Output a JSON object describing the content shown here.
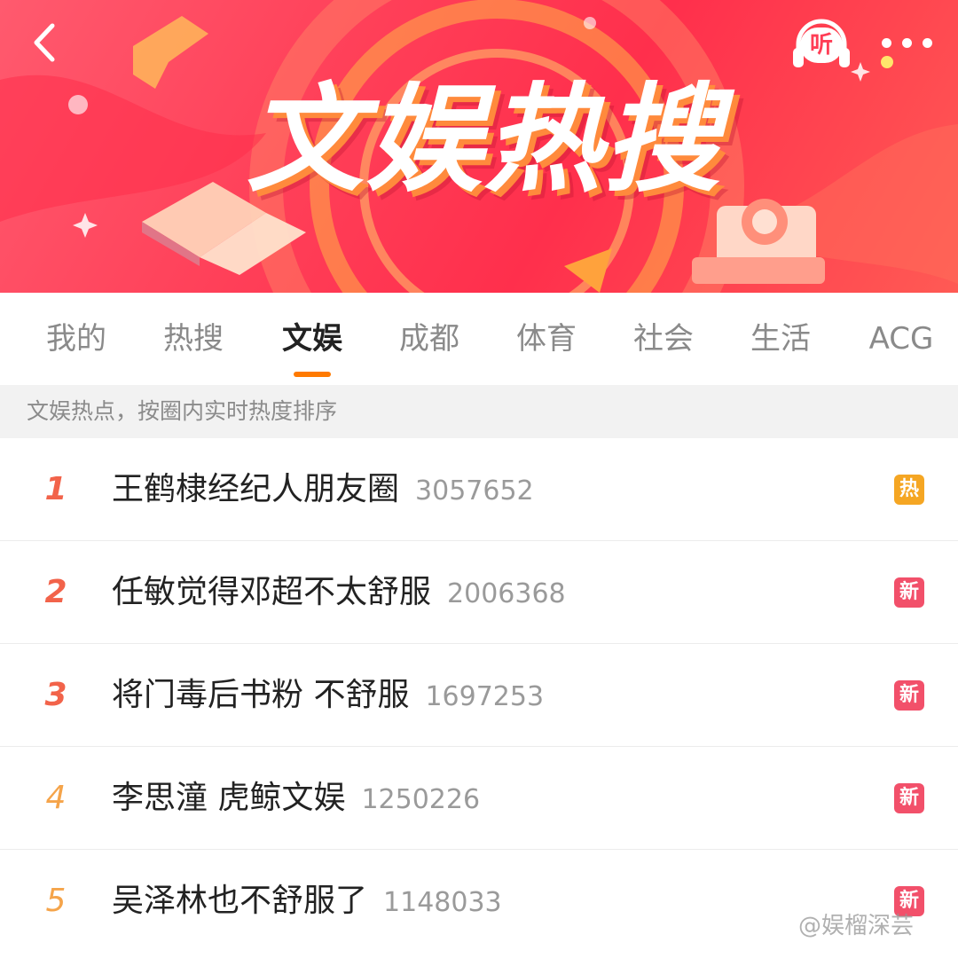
{
  "banner": {
    "title": "文娱热搜",
    "listen_label": "听",
    "back_icon": "chevron-left-icon",
    "listen_icon": "headphones-icon",
    "more_icon": "more-dots-icon"
  },
  "tabs": [
    {
      "label": "我的",
      "active": false
    },
    {
      "label": "热搜",
      "active": false
    },
    {
      "label": "文娱",
      "active": true
    },
    {
      "label": "成都",
      "active": false
    },
    {
      "label": "体育",
      "active": false
    },
    {
      "label": "社会",
      "active": false
    },
    {
      "label": "生活",
      "active": false
    },
    {
      "label": "ACG",
      "active": false
    }
  ],
  "section": {
    "description": "文娱热点，按圈内实时热度排序"
  },
  "list": [
    {
      "rank": "1",
      "title": "王鹤棣经纪人朋友圈",
      "count": "3057652",
      "badge": "热",
      "badge_type": "hot"
    },
    {
      "rank": "2",
      "title": "任敏觉得邓超不太舒服",
      "count": "2006368",
      "badge": "新",
      "badge_type": "new"
    },
    {
      "rank": "3",
      "title": "将门毒后书粉 不舒服",
      "count": "1697253",
      "badge": "新",
      "badge_type": "new"
    },
    {
      "rank": "4",
      "title": "李思潼 虎鲸文娱",
      "count": "1250226",
      "badge": "新",
      "badge_type": "new"
    },
    {
      "rank": "5",
      "title": "吴泽林也不舒服了",
      "count": "1148033",
      "badge": "新",
      "badge_type": "new"
    }
  ],
  "watermark": "@娱榴深芸",
  "colors": {
    "accent": "#ff7a00",
    "banner": "#ff3f58",
    "rank_top": "#f2634a",
    "rank_other": "#f5a44a",
    "badge_hot": "#f5a623",
    "badge_new": "#f2506a"
  }
}
